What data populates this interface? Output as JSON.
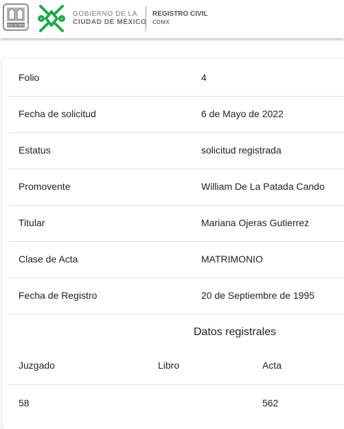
{
  "header": {
    "gobierno_line1": "GOBIERNO DE LA",
    "gobierno_line2": "CIUDAD DE MÉXICO",
    "registro_line1": "REGISTRO CIVIL",
    "registro_line2": "CDMX",
    "seal_text": "CIUDAD DE MÉXICO",
    "colors": {
      "brand_green": "#1fa94a",
      "gray": "#8a8a8a"
    }
  },
  "details": [
    {
      "label": "Folio",
      "value": "4"
    },
    {
      "label": "Fecha de solicitud",
      "value": "6 de Mayo de 2022"
    },
    {
      "label": "Estatus",
      "value": "solicitud registrada"
    },
    {
      "label": "Promovente",
      "value": "William De La Patada Cando"
    },
    {
      "label": "Titular",
      "value": "Mariana Ojeras Gutierrez"
    },
    {
      "label": "Clase de Acta",
      "value": "MATRIMONIO"
    },
    {
      "label": "Fecha de Registro",
      "value": "20 de Septiembre de 1995"
    }
  ],
  "registral": {
    "title": "Datos registrales",
    "headers": [
      "Juzgado",
      "Libro",
      "Acta"
    ],
    "rows": [
      [
        "58",
        "",
        "562"
      ]
    ]
  }
}
